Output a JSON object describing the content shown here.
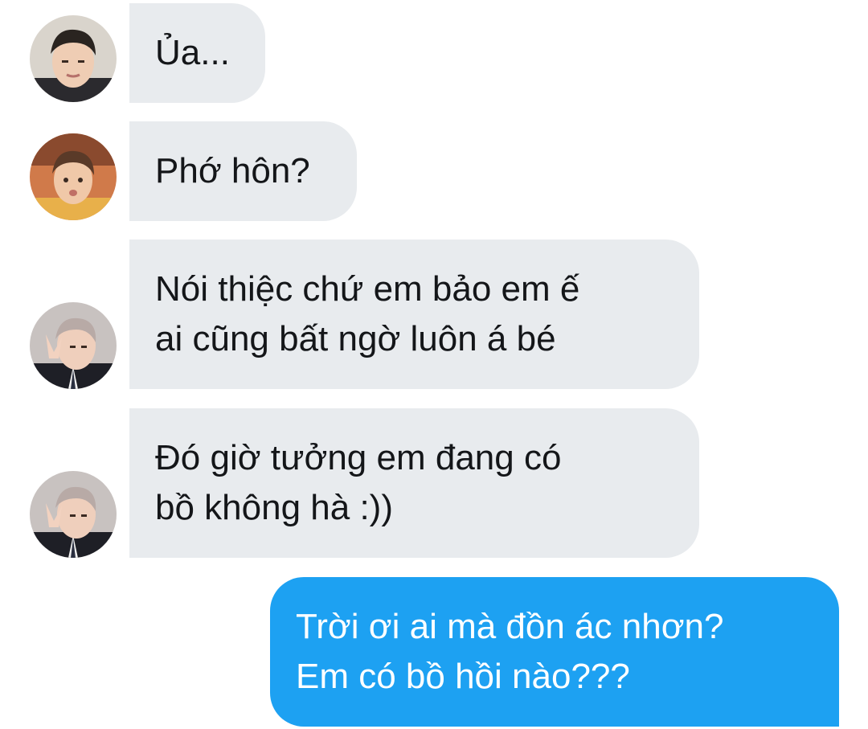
{
  "colors": {
    "incoming_bubble": "#e8ebee",
    "outgoing_bubble": "#1da1f2",
    "incoming_text": "#141619",
    "outgoing_text": "#ffffff"
  },
  "messages": [
    {
      "direction": "incoming",
      "avatar": "avatar-photo-1",
      "lines": [
        "Ủa..."
      ]
    },
    {
      "direction": "incoming",
      "avatar": "avatar-photo-2",
      "lines": [
        "Phớ hôn?"
      ]
    },
    {
      "direction": "incoming",
      "avatar": "avatar-photo-3",
      "lines": [
        "Nói thiệc chứ em bảo em ế",
        "ai cũng bất ngờ luôn á bé"
      ]
    },
    {
      "direction": "incoming",
      "avatar": "avatar-photo-3",
      "lines": [
        "Đó giờ tưởng em đang có",
        "bồ không hà :))"
      ]
    },
    {
      "direction": "outgoing",
      "lines": [
        "Trời ơi ai mà đồn ác nhơn?",
        "Em có bồ hồi nào???"
      ]
    }
  ]
}
